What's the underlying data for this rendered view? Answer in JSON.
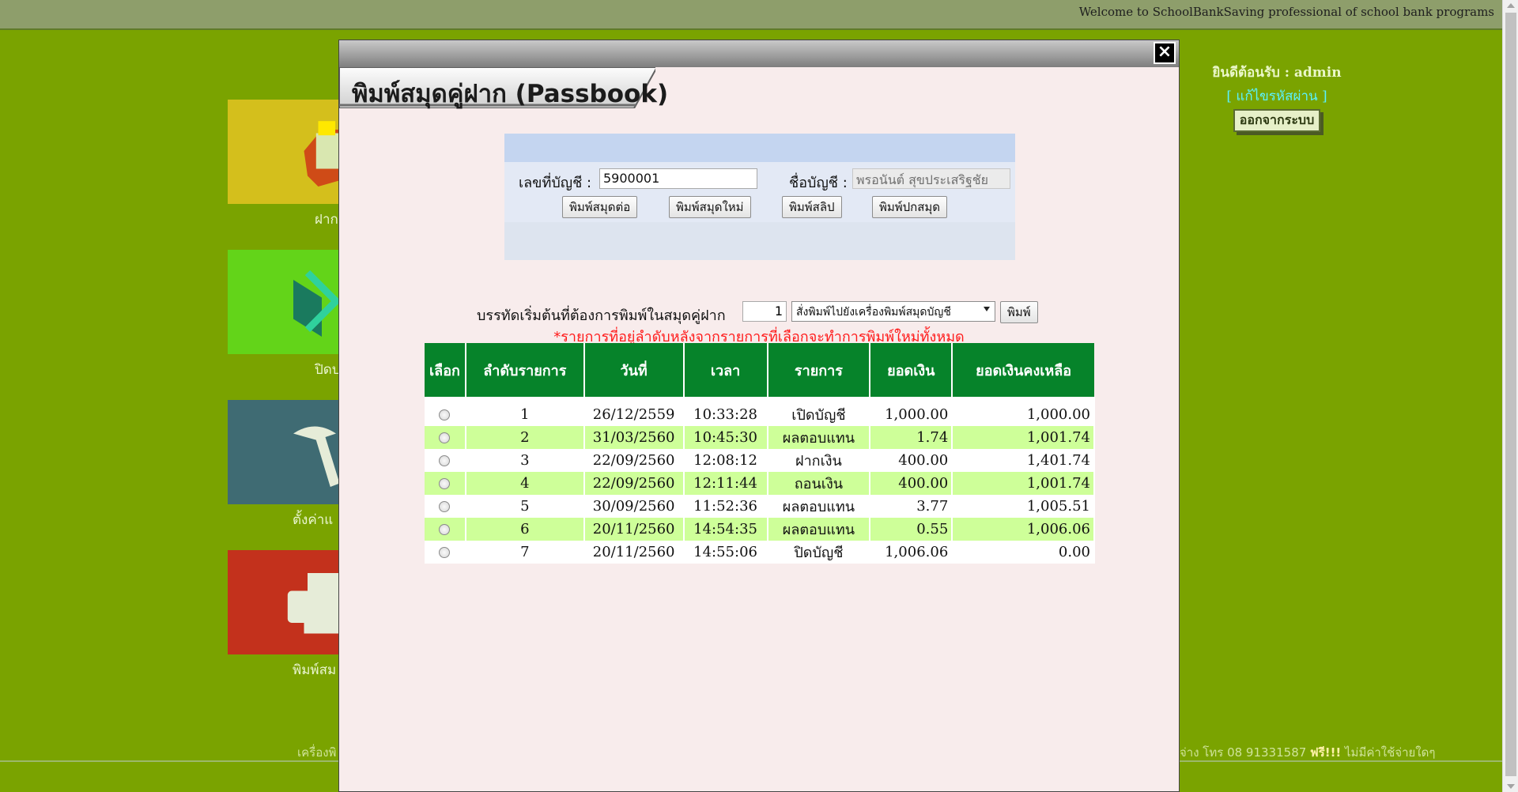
{
  "topbar": {
    "welcome": "Welcome to SchoolBankSaving professional of school bank programs"
  },
  "user": {
    "greeting": "ยินดีต้อนรับ : admin",
    "change_password": "[ แก้ไขรหัสผ่าน ]",
    "logout": "ออกจากระบบ"
  },
  "menu": {
    "tiles": [
      {
        "label": "ฝาก",
        "icon": "money-bag-icon",
        "color": "#d4bf1c"
      },
      {
        "label": "ปิดบ",
        "icon": "book-arrow-icon",
        "color": "#63d419"
      },
      {
        "label": "ตั้งค่าแ",
        "icon": "tools-icon",
        "color": "#3f6b73"
      },
      {
        "label": "พิมพ์สม",
        "icon": "printer-icon",
        "color": "#c3311c"
      }
    ]
  },
  "footer": {
    "left": "เครื่องพิ",
    "right_prefix": "จ่าง โทร 08 91331587 ",
    "right_free": "ฟรี!!!",
    "right_suffix": " ไม่มีค่าใช้จ่ายใดๆ"
  },
  "modal": {
    "title": "พิมพ์สมุดคู่ฝาก (Passbook)",
    "close": "×",
    "account_no_label": "เลขที่บัญชี :",
    "account_no_value": "5900001",
    "account_name_label": "ชื่อบัญชี :",
    "account_name_value": "พรอนันต์ สุขประเสริฐชัย",
    "buttons": {
      "continue_book": "พิมพ์สมุดต่อ",
      "new_book": "พิมพ์สมุดใหม่",
      "slip": "พิมพ์สลิป",
      "cover": "พิมพ์ปกสมุด"
    },
    "print_line_label": "บรรทัดเริ่มต้นที่ต้องการพิมพ์ในสมุดคู่ฝาก",
    "print_line_value": "1",
    "printer_option": "สั่งพิมพ์ไปยังเครื่องพิมพ์สมุดบัญชี",
    "print_button": "พิมพ์",
    "warning": "*รายการที่อยู่ลำดับหลังจากรายการที่เลือกจะทำการพิมพ์ใหม่ทั้งหมด",
    "table": {
      "headers": [
        "เลือก",
        "ลำดับรายการ",
        "วันที่",
        "เวลา",
        "รายการ",
        "ยอดเงิน",
        "ยอดเงินคงเหลือ"
      ],
      "rows": [
        [
          "1",
          "26/12/2559",
          "10:33:28",
          "เปิดบัญชี",
          "1,000.00",
          "1,000.00"
        ],
        [
          "2",
          "31/03/2560",
          "10:45:30",
          "ผลตอบแทน",
          "1.74",
          "1,001.74"
        ],
        [
          "3",
          "22/09/2560",
          "12:08:12",
          "ฝากเงิน",
          "400.00",
          "1,401.74"
        ],
        [
          "4",
          "22/09/2560",
          "12:11:44",
          "ถอนเงิน",
          "400.00",
          "1,001.74"
        ],
        [
          "5",
          "30/09/2560",
          "11:52:36",
          "ผลตอบแทน",
          "3.77",
          "1,005.51"
        ],
        [
          "6",
          "20/11/2560",
          "14:54:35",
          "ผลตอบแทน",
          "0.55",
          "1,006.06"
        ],
        [
          "7",
          "20/11/2560",
          "14:55:06",
          "ปิดบัญชี",
          "1,006.06",
          "0.00"
        ]
      ]
    }
  }
}
